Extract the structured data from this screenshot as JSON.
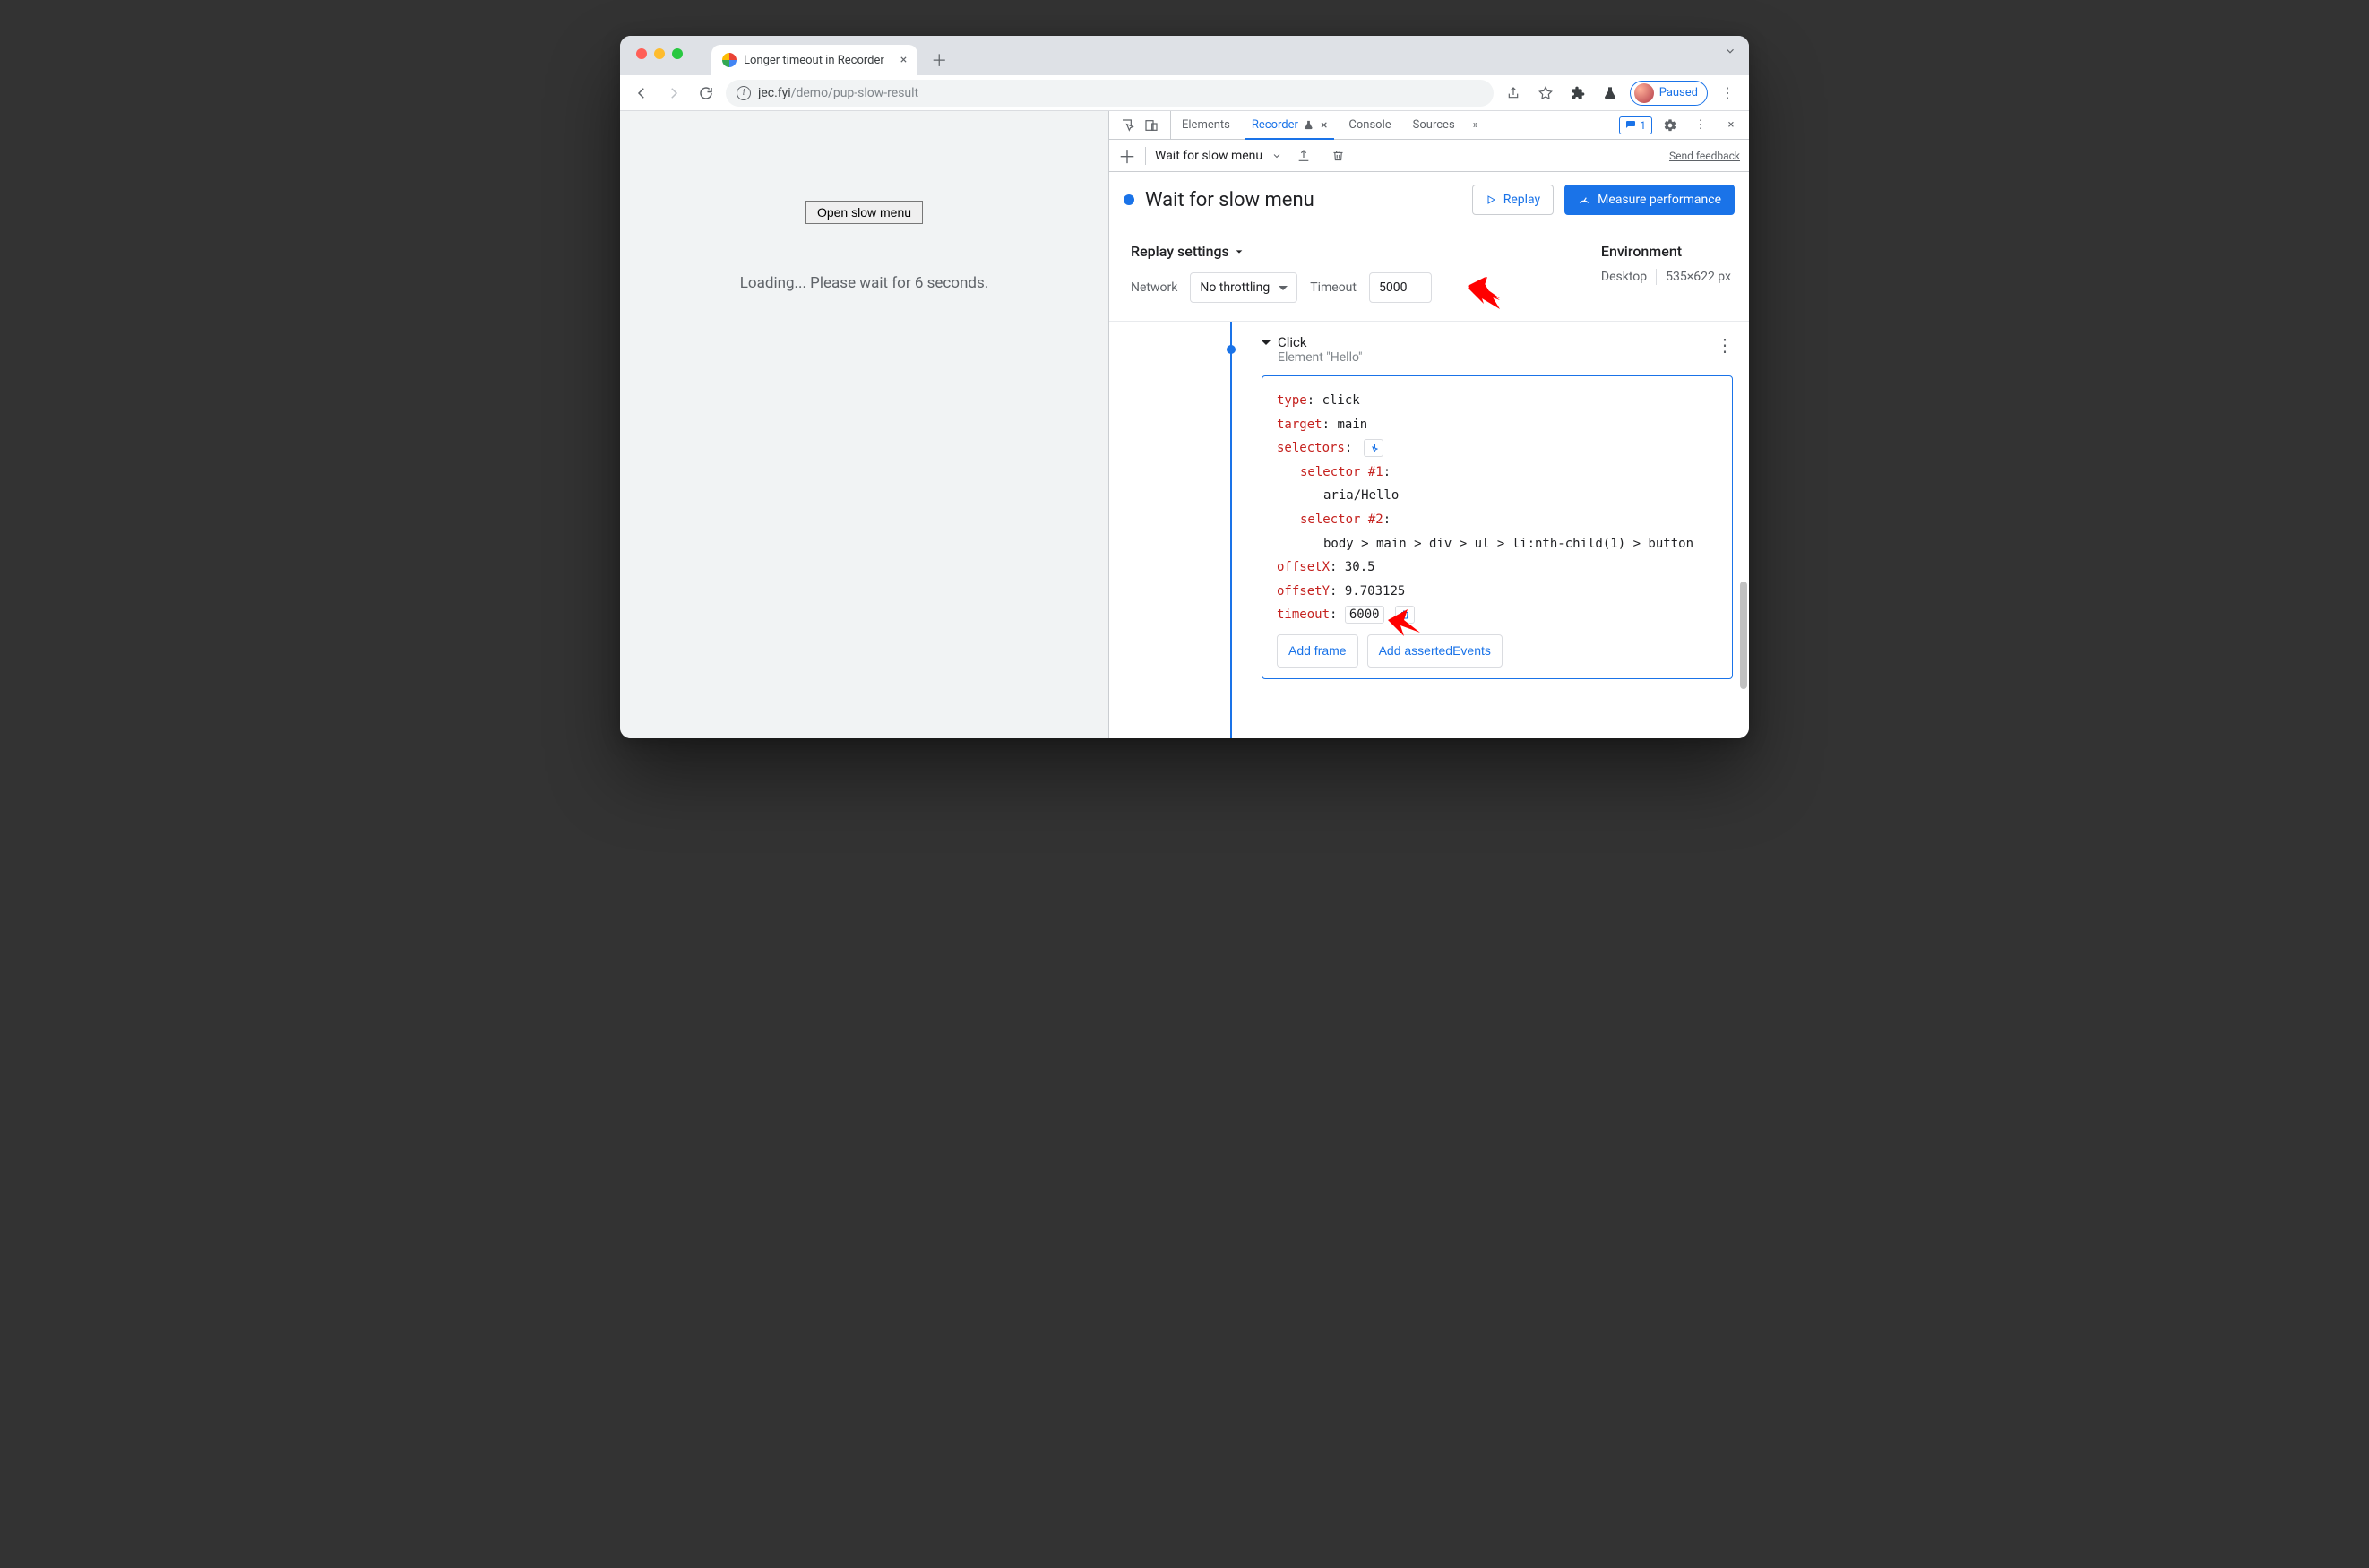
{
  "browser": {
    "tab_title": "Longer timeout in Recorder",
    "url_host": "jec.fyi",
    "url_path": "/demo/pup-slow-result",
    "profile_label": "Paused"
  },
  "page": {
    "button": "Open slow menu",
    "loading": "Loading... Please wait for 6 seconds."
  },
  "devtools": {
    "tabs": {
      "elements": "Elements",
      "recorder": "Recorder",
      "console": "Console",
      "sources": "Sources"
    },
    "issues_count": "1",
    "recorder": {
      "recording_menu": "Wait for slow menu",
      "send_feedback": "Send feedback",
      "title": "Wait for slow menu",
      "replay": "Replay",
      "measure": "Measure performance",
      "replay_settings": "Replay settings",
      "network_label": "Network",
      "network_value": "No throttling",
      "timeout_label": "Timeout",
      "timeout_value": "5000",
      "env_label": "Environment",
      "env_device": "Desktop",
      "env_size": "535×622 px"
    },
    "step": {
      "title": "Click",
      "subtitle": "Element \"Hello\"",
      "type_key": "type",
      "type_val": "click",
      "target_key": "target",
      "target_val": "main",
      "selectors_key": "selectors",
      "sel1_key": "selector #1",
      "sel1_val": "aria/Hello",
      "sel2_key": "selector #2",
      "sel2_val": "body > main > div > ul > li:nth-child(1) > button",
      "offx_key": "offsetX",
      "offx_val": "30.5",
      "offy_key": "offsetY",
      "offy_val": "9.703125",
      "timeout_key": "timeout",
      "timeout_val": "6000",
      "add_frame": "Add frame",
      "add_asserted": "Add assertedEvents"
    }
  }
}
